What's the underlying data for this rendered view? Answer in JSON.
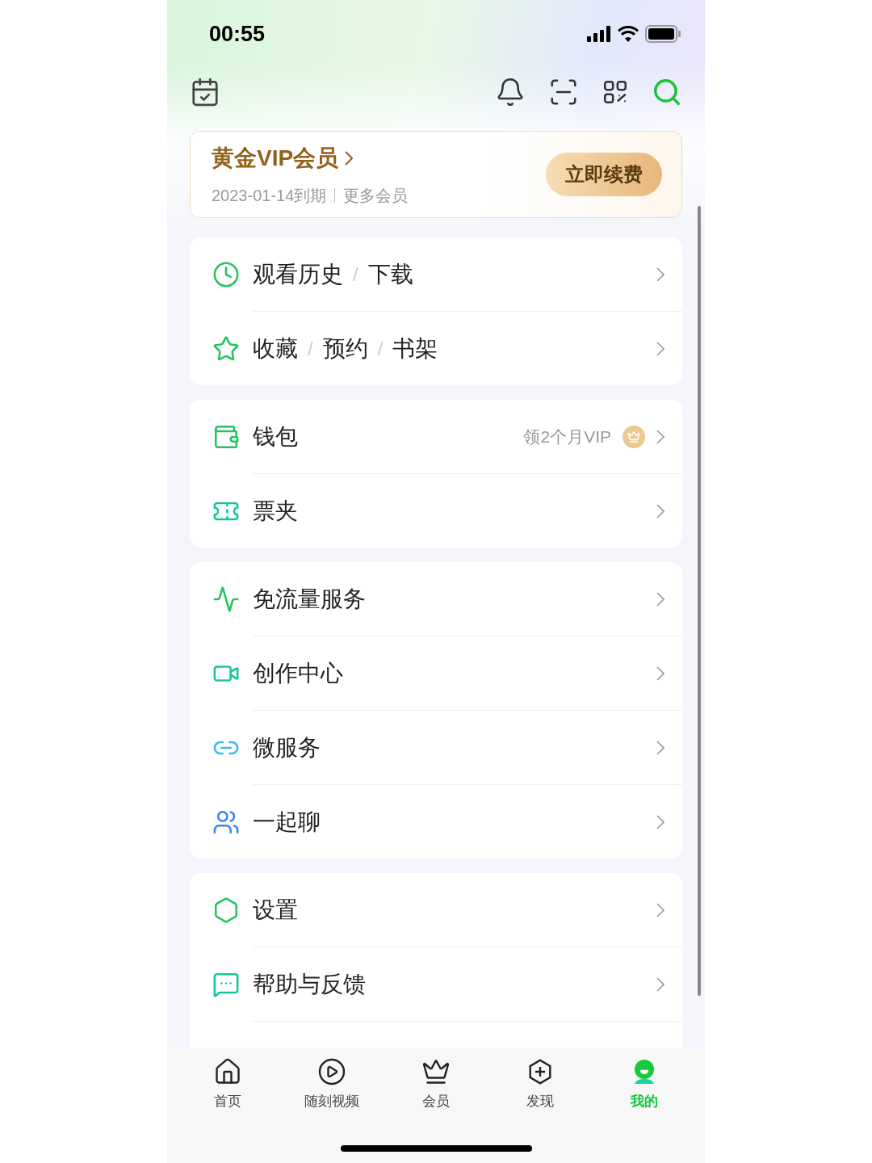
{
  "status_bar": {
    "time": "00:55"
  },
  "vip_card": {
    "title": "黄金VIP会员",
    "expiry": "2023-01-14到期",
    "more": "更多会员",
    "button": "立即续费"
  },
  "groups": [
    {
      "items": [
        {
          "parts": [
            "观看历史",
            "下载"
          ],
          "separator": "/"
        },
        {
          "parts": [
            "收藏",
            "预约",
            "书架"
          ],
          "separator": "/"
        }
      ]
    },
    {
      "items": [
        {
          "parts": [
            "钱包"
          ],
          "promo": "领2个月VIP"
        },
        {
          "parts": [
            "票夹"
          ]
        }
      ]
    },
    {
      "items": [
        {
          "parts": [
            "免流量服务"
          ]
        },
        {
          "parts": [
            "创作中心"
          ]
        },
        {
          "parts": [
            "微服务"
          ]
        },
        {
          "parts": [
            "一起聊"
          ]
        }
      ]
    },
    {
      "items": [
        {
          "parts": [
            "设置"
          ]
        },
        {
          "parts": [
            "帮助与反馈"
          ]
        }
      ]
    }
  ],
  "tab_bar": [
    {
      "label": "首页",
      "selected": false
    },
    {
      "label": "随刻视频",
      "selected": false
    },
    {
      "label": "会员",
      "selected": false
    },
    {
      "label": "发现",
      "selected": false
    },
    {
      "label": "我的",
      "selected": true
    }
  ]
}
